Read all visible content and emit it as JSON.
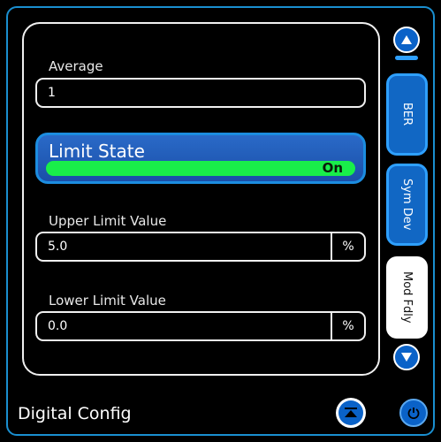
{
  "fields": {
    "average": {
      "label": "Average",
      "value": "1"
    },
    "upper_limit": {
      "label": "Upper Limit Value",
      "value": "5.0",
      "unit": "%"
    },
    "lower_limit": {
      "label": "Lower Limit Value",
      "value": "0.0",
      "unit": "%"
    }
  },
  "limit_state": {
    "label": "Limit State",
    "status": "On"
  },
  "side_tabs": [
    {
      "label": "BER",
      "active": false
    },
    {
      "label": "Sym Dev",
      "active": false
    },
    {
      "label": "Mod Fdly",
      "active": true
    }
  ],
  "footer": {
    "title": "Digital Config"
  },
  "icons": {
    "scroll_up": "chevron-up-icon",
    "scroll_down": "chevron-down-icon",
    "collapse": "collapse-to-top-icon",
    "power": "power-icon"
  },
  "colors": {
    "accent": "#1a8fd0",
    "on_green": "#19ee4a",
    "tab_blue": "#1167c4"
  }
}
